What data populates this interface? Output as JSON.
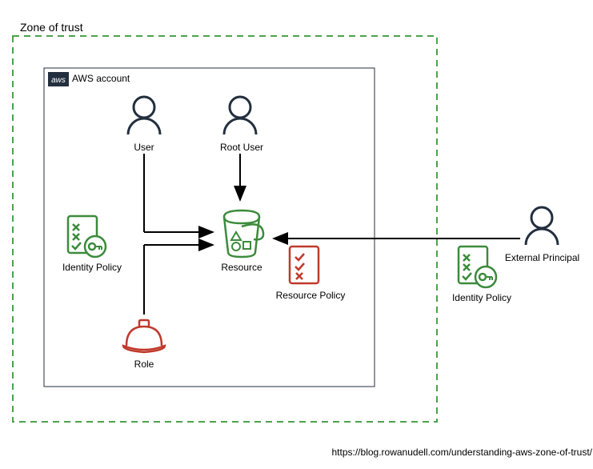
{
  "title": "Zone of trust",
  "accountLabel": "AWS account",
  "nodes": {
    "user": "User",
    "rootUser": "Root User",
    "identityPolicy1": "Identity Policy",
    "resource": "Resource",
    "resourcePolicy": "Resource Policy",
    "role": "Role",
    "identityPolicy2": "Identity Policy",
    "externalPrincipal": "External Principal"
  },
  "source": "https://blog.rowanudell.com/understanding-aws-zone-of-trust/",
  "colors": {
    "trustBorder": "#4ca24c",
    "accountBorder": "#232f3e",
    "iconDark": "#232f3e",
    "iconGreen": "#3c8b3c",
    "iconRed": "#c0392b"
  }
}
